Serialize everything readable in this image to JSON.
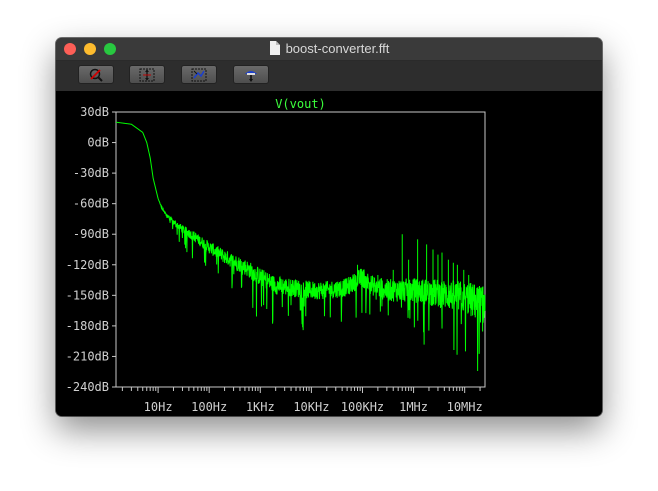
{
  "window": {
    "title": "boost-converter.fft"
  },
  "toolbar": {
    "buttons": [
      {
        "icon": "zoom-cancel-icon"
      },
      {
        "icon": "vertical-zoom-icon"
      },
      {
        "icon": "auto-range-icon"
      },
      {
        "icon": "pick-visible-traces-icon"
      }
    ]
  },
  "colors": {
    "trace": "#00ff00",
    "background": "#000000",
    "axis": "#c8c8c8"
  },
  "chart_data": {
    "type": "line",
    "title": "V(vout)",
    "x_scale": "log",
    "y_unit": "dB",
    "xlim": [
      1.5,
      25000000
    ],
    "ylim": [
      -240,
      30
    ],
    "x_ticks": [
      10,
      100,
      1000,
      10000,
      100000,
      1000000,
      10000000
    ],
    "x_tick_labels": [
      "10Hz",
      "100Hz",
      "1KHz",
      "10KHz",
      "100KHz",
      "1MHz",
      "10MHz"
    ],
    "y_ticks": [
      30,
      0,
      -30,
      -60,
      -90,
      -120,
      -150,
      -180,
      -210,
      -240
    ],
    "y_tick_labels": [
      "30dB",
      "0dB",
      "-30dB",
      "-60dB",
      "-90dB",
      "-120dB",
      "-150dB",
      "-180dB",
      "-210dB",
      "-240dB"
    ],
    "series": [
      {
        "name": "V(vout)",
        "x": [
          1.5,
          3,
          5,
          6,
          7,
          8,
          10,
          12,
          15,
          20,
          30,
          50,
          100,
          200,
          500,
          1000,
          2000,
          5000,
          10000,
          20000,
          50000,
          80000,
          100000,
          150000,
          300000,
          1000000,
          3000000,
          10000000,
          25000000
        ],
        "y": [
          20,
          18,
          10,
          0,
          -15,
          -35,
          -55,
          -65,
          -72,
          -78,
          -85,
          -92,
          -103,
          -112,
          -122,
          -132,
          -140,
          -143,
          -145,
          -145,
          -142,
          -135,
          -132,
          -140,
          -145,
          -145,
          -148,
          -152,
          -160
        ],
        "noise_band_db": [
          0,
          0,
          0,
          0,
          0,
          0,
          0,
          2,
          4,
          6,
          8,
          10,
          12,
          14,
          16,
          18,
          18,
          18,
          18,
          18,
          18,
          18,
          20,
          20,
          22,
          24,
          28,
          32,
          40
        ],
        "spikes": [
          {
            "x": 80000,
            "y": -120
          },
          {
            "x": 200000,
            "y": -130
          },
          {
            "x": 400000,
            "y": -125
          },
          {
            "x": 600000,
            "y": -90
          },
          {
            "x": 800000,
            "y": -115
          },
          {
            "x": 1200000,
            "y": -95
          },
          {
            "x": 1800000,
            "y": -100
          },
          {
            "x": 2400000,
            "y": -105
          },
          {
            "x": 3000000,
            "y": -110
          },
          {
            "x": 3600000,
            "y": -108
          },
          {
            "x": 4800000,
            "y": -115
          },
          {
            "x": 6000000,
            "y": -118
          },
          {
            "x": 7200000,
            "y": -120
          },
          {
            "x": 9600000,
            "y": -125
          },
          {
            "x": 12000000,
            "y": -130
          }
        ]
      }
    ]
  }
}
